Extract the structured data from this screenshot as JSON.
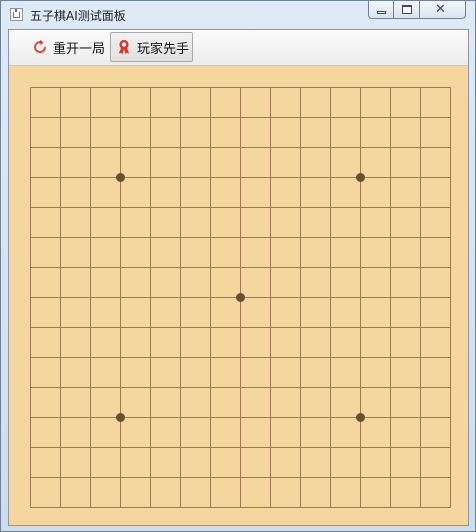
{
  "window": {
    "title": "五子棋AI测试面板",
    "icon": "java-app-icon",
    "controls": {
      "minimize_icon": "minimize-icon",
      "maximize_icon": "maximize-icon",
      "close_icon": "close-icon",
      "close_glyph": "✕"
    }
  },
  "toolbar": {
    "restart_label": "重开一局",
    "restart_icon": "restart-icon",
    "player_first_label": "玩家先手",
    "player_first_icon": "ribbon-icon",
    "restart_icon_color": "#e03c2c",
    "player_first_icon_color": "#d8362a"
  },
  "board": {
    "lines": 15,
    "star_points": [
      [
        3,
        3
      ],
      [
        11,
        3
      ],
      [
        7,
        7
      ],
      [
        3,
        11
      ],
      [
        11,
        11
      ]
    ],
    "background_color": "#f5d69e",
    "line_color": "#a07a4c",
    "star_color": "#6d4e2e",
    "stones": []
  }
}
